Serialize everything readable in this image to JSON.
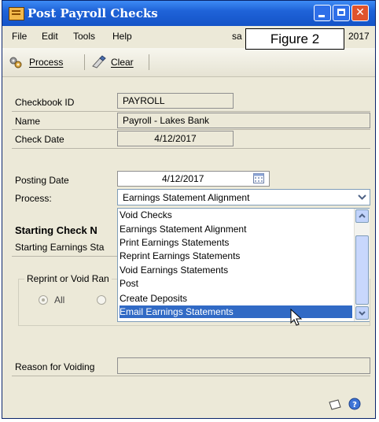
{
  "window": {
    "title": "Post Payroll Checks"
  },
  "menu": {
    "items": [
      "File",
      "Edit",
      "Tools",
      "Help"
    ],
    "user": "sa",
    "date_tail": "2017"
  },
  "figure_label": "Figure 2",
  "toolbar": {
    "process_label": "Process",
    "process_accel": "P",
    "clear_label": "Clear",
    "clear_accel": "C"
  },
  "form": {
    "checkbook_id_label": "Checkbook ID",
    "checkbook_id_value": "PAYROLL",
    "name_label": "Name",
    "name_value": "Payroll - Lakes Bank",
    "check_date_label": "Check Date",
    "check_date_value": "4/12/2017",
    "posting_date_label": "Posting Date",
    "posting_date_value": "4/12/2017",
    "process_label": "Process:",
    "process_value": "Earnings Statement Alignment",
    "starting_check_label": "Starting Check N",
    "starting_earnings_label": "Starting Earnings Sta",
    "reprint_group_label": "Reprint or Void Ran",
    "all_label": "All",
    "reason_label": "Reason for Voiding"
  },
  "process_options": [
    "Void Checks",
    "Earnings Statement Alignment",
    "Print Earnings Statements",
    "Reprint Earnings Statements",
    "Void Earnings Statements",
    "Post",
    "Create Deposits",
    "Email Earnings Statements"
  ],
  "selected_option_index": 7,
  "icons": [
    "process-icon",
    "clear-icon",
    "calendar-icon",
    "chevron-down-icon",
    "note-icon",
    "help-icon"
  ]
}
